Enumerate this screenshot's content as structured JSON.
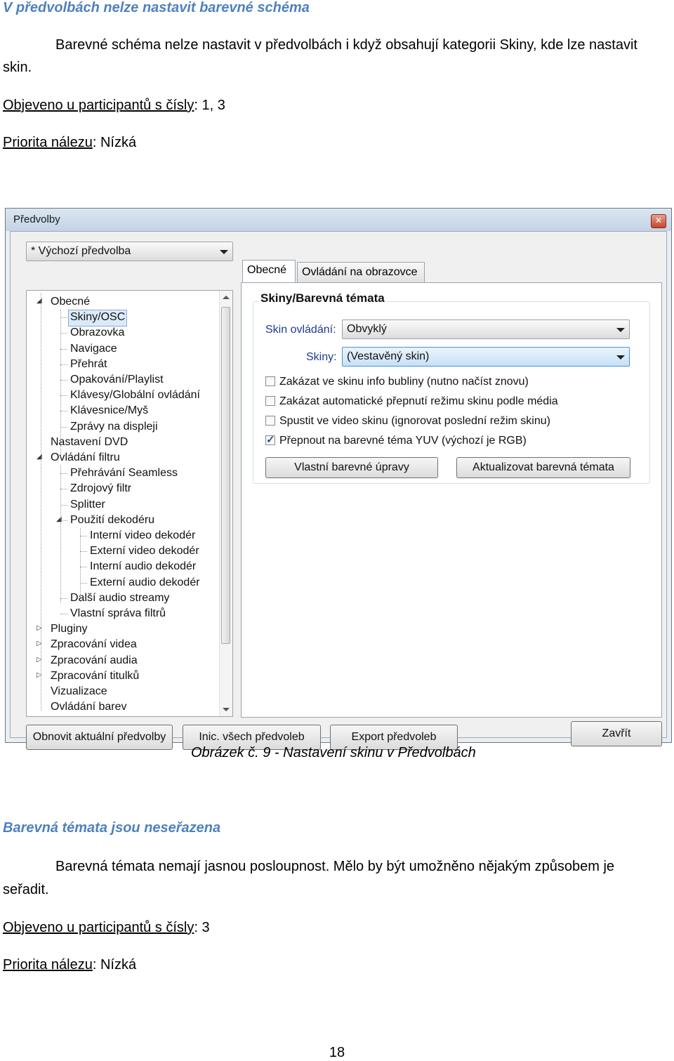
{
  "section1": {
    "heading": "V předvolbách nelze nastavit barevné schéma",
    "para_line1": "Barevné schéma nelze nastavit v předvolbách i když obsahují kategorii Skiny, kde lze nastavit",
    "para_line2": "skin.",
    "found_label": "Objeveno u participantů s čísly",
    "found_value": ": 1, 3",
    "priority_label": "Priorita nálezu",
    "priority_value": ": Nízká"
  },
  "dialog": {
    "title": "Předvolby",
    "close_glyph": "✕",
    "preset": "* Výchozí předvolba",
    "tabs": [
      "Obecné",
      "Ovládání na obrazovce"
    ],
    "group_title": "Skiny/Barevná témata",
    "skin_control_label": "Skin ovládání:",
    "skin_control_value": "Obvyklý",
    "skins_label": "Skiny:",
    "skins_value": "(Vestavěný skin)",
    "checkboxes": [
      "Zakázat ve skinu info bubliny (nutno načíst znovu)",
      "Zakázat automatické přepnutí režimu skinu podle média",
      "Spustit ve video skinu (ignorovat poslední režim skinu)",
      "Přepnout na barevné téma YUV (výchozí je RGB)"
    ],
    "btn_custom": "Vlastní barevné úpravy",
    "btn_refresh": "Aktualizovat barevná témata",
    "tree": [
      "Obecné",
      "Skiny/OSC",
      "Obrazovka",
      "Navigace",
      "Přehrát",
      "Opakování/Playlist",
      "Klávesy/Globální ovládání",
      "Klávesnice/Myš",
      "Zprávy na displeji",
      "Nastavení DVD",
      "Ovládání filtru",
      "Přehrávání Seamless",
      "Zdrojový filtr",
      "Splitter",
      "Použití dekodéru",
      "Interní video dekodér",
      "Externí video dekodér",
      "Interní audio dekodér",
      "Externí audio dekodér",
      "Další audio streamy",
      "Vlastní správa filtrů",
      "Pluginy",
      "Zpracování videa",
      "Zpracování audia",
      "Zpracování titulků",
      "Vizualizace",
      "Ovládání barev"
    ],
    "btn_reset": "Obnovit aktuální předvolby",
    "btn_init": "Inic. všech předvoleb",
    "btn_export": "Export předvoleb",
    "btn_close": "Zavřít"
  },
  "caption": "Obrázek č. 9 - Nastavení skinu v Předvolbách",
  "section2": {
    "heading": "Barevná témata jsou neseřazena",
    "para_line1": "Barevná témata nemají jasnou posloupnost. Mělo by být umožněno nějakým způsobem je",
    "para_line2": "seřadit.",
    "found_label": "Objeveno u participantů s čísly",
    "found_value": ":  3",
    "priority_label": "Priorita nálezu",
    "priority_value": ": Nízká"
  },
  "page_number": "18"
}
